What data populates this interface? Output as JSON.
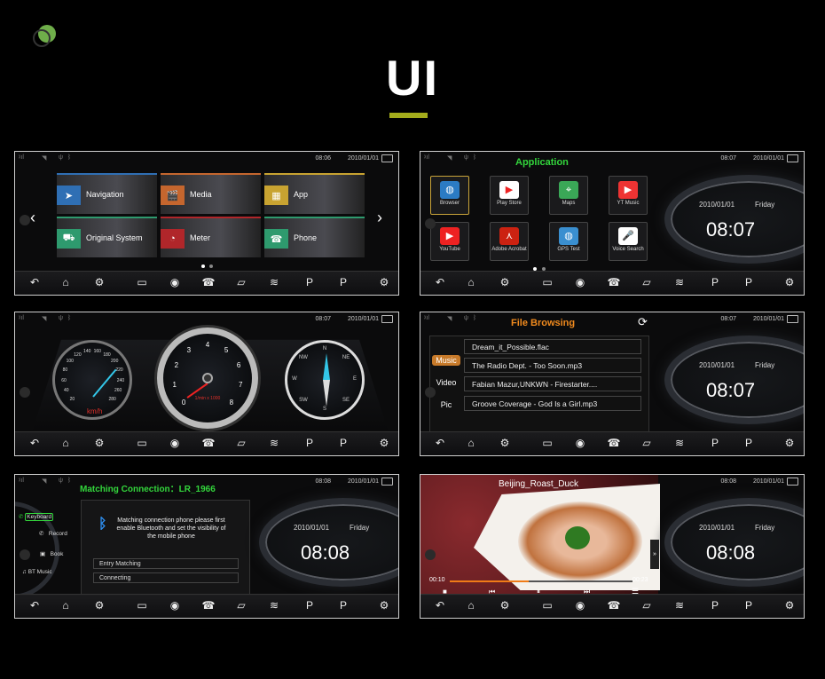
{
  "header": {
    "title": "UI"
  },
  "colors": {
    "accent_bar": "#a4ac1c",
    "green_title": "#33d63c",
    "orange_title": "#f08a1e",
    "progress": "#f07b17"
  },
  "nav_icons": [
    "back-icon",
    "home-icon",
    "settings-icon",
    "camera-icon",
    "navigation-icon",
    "phone-icon",
    "media-icon",
    "climate-icon",
    "parking-front-icon",
    "parking-rear-icon",
    "car-settings-icon"
  ],
  "panels": {
    "home": {
      "time": "08:06",
      "date": "2010/01/01",
      "tiles": [
        {
          "label": "Navigation",
          "color": "#2f6fb4"
        },
        {
          "label": "Media",
          "color": "#c5662e"
        },
        {
          "label": "App",
          "color": "#c8a331"
        },
        {
          "label": "Original System",
          "color": "#2e9a6e"
        },
        {
          "label": "Meter",
          "color": "#b0262a"
        },
        {
          "label": "Phone",
          "color": "#2e9a6e"
        }
      ],
      "page_dots": 2,
      "active_dot": 1
    },
    "apps": {
      "time": "08:07",
      "date": "2010/01/01",
      "title": "Application",
      "apps": [
        "Browser",
        "Play Store",
        "Maps",
        "YT Music",
        "YouTube",
        "Adobe Acrobat",
        "GPS Test",
        "Voice Search"
      ],
      "clock": {
        "date": "2010/01/01",
        "day": "Friday",
        "time": "08:07"
      }
    },
    "gauges": {
      "time": "08:07",
      "date": "2010/01/01",
      "speed_unit": "km/h",
      "speed_ticks": [
        "20",
        "40",
        "60",
        "80",
        "100",
        "120",
        "140",
        "160",
        "180",
        "200",
        "220",
        "240",
        "260",
        "280"
      ],
      "rpm_ticks": [
        "0",
        "1",
        "2",
        "3",
        "4",
        "5",
        "6",
        "7",
        "8"
      ],
      "rpm_unit": "1/min x 1000",
      "compass": [
        "N",
        "NE",
        "E",
        "SE",
        "S",
        "SW",
        "W",
        "NW"
      ]
    },
    "files": {
      "time": "08:07",
      "date": "2010/01/01",
      "title": "File Browsing",
      "tabs": [
        "Music",
        "Video",
        "Pic"
      ],
      "active_tab": "Music",
      "files": [
        "Dream_it_Possible.flac",
        "The Radio Dept. - Too Soon.mp3",
        "Fabian Mazur,UNKWN - Firestarter....",
        "Groove Coverage - God Is a Girl.mp3"
      ],
      "clock": {
        "date": "2010/01/01",
        "day": "Friday",
        "time": "08:07"
      }
    },
    "bluetooth": {
      "time": "08:08",
      "date": "2010/01/01",
      "title": "Matching Connection：LR_1966",
      "menu": [
        "Keyboard",
        "Record",
        "Book",
        "BT Music"
      ],
      "message": "Matching connection phone please first enable Bluetooth and set the visibility of the mobile phone",
      "fields": [
        "Entry Matching",
        "Connecting"
      ],
      "clock": {
        "date": "2010/01/01",
        "day": "Friday",
        "time": "08:08"
      }
    },
    "video": {
      "time": "08:08",
      "date": "2010/01/01",
      "title": "Beijing_Roast_Duck",
      "elapsed": "00:10",
      "duration": "00:23",
      "progress": 0.43,
      "clock": {
        "date": "2010/01/01",
        "day": "Friday",
        "time": "08:08"
      }
    }
  }
}
